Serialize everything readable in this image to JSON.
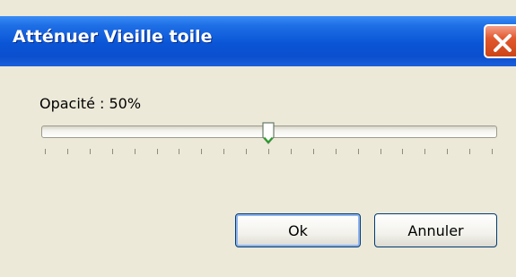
{
  "window": {
    "title": "Atténuer Vieille toile"
  },
  "dialog": {
    "opacity_label": "Opacité : 50%",
    "opacity_value": 50,
    "ok_label": "Ok",
    "cancel_label": "Annuler"
  },
  "icons": {
    "close": "close-icon",
    "thumb": "slider-thumb"
  },
  "colors": {
    "title_bar": "#0a55d6",
    "close_button": "#e2592f",
    "dialog_bg": "#ece9d8",
    "thumb_accent": "#21a121"
  }
}
